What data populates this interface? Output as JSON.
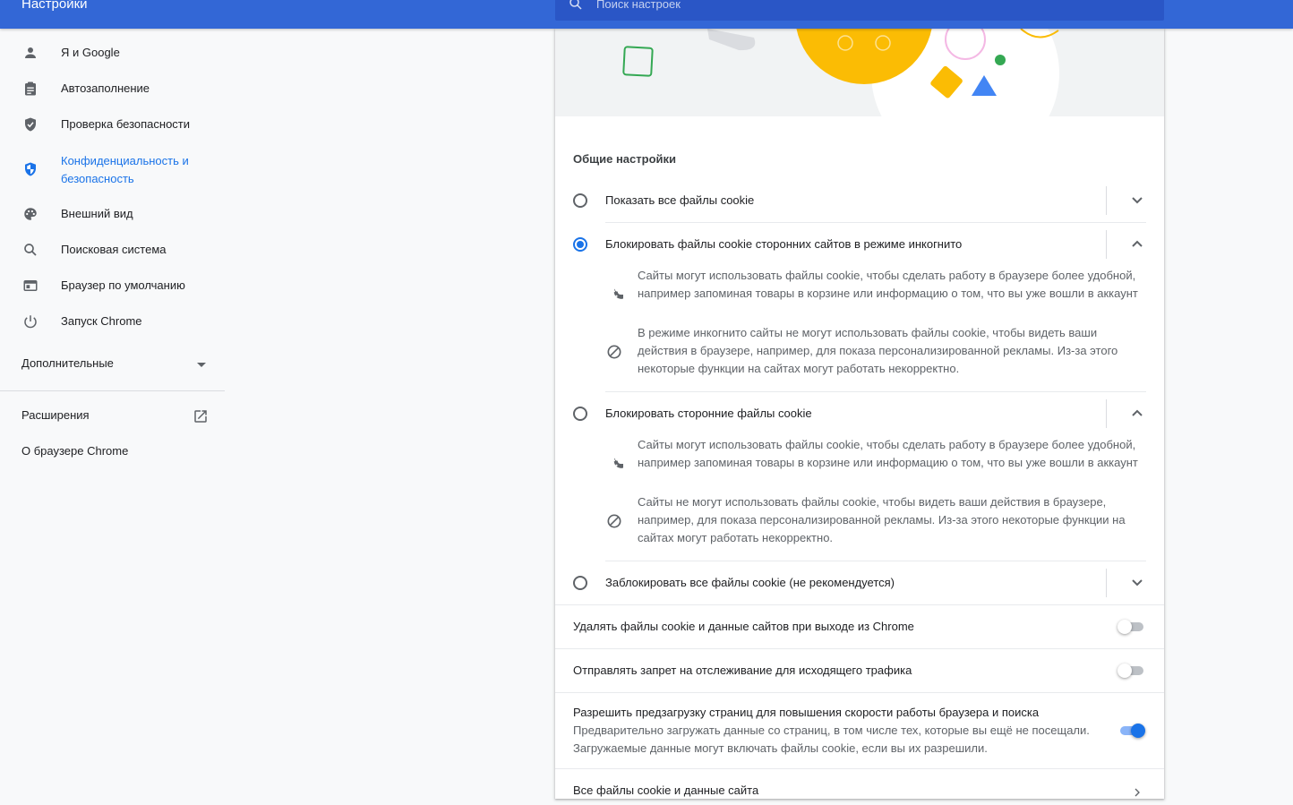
{
  "header": {
    "title": "Настройки",
    "search_placeholder": "Поиск настроек"
  },
  "sidebar": {
    "items": [
      {
        "label": "Я и Google",
        "icon": "person-icon"
      },
      {
        "label": "Автозаполнение",
        "icon": "clipboard-icon"
      },
      {
        "label": "Проверка безопасности",
        "icon": "shield-check-icon"
      },
      {
        "label": "Конфиденциальность и безопасность",
        "label_line1": "Конфиденциальность и",
        "label_line2": "безопасность",
        "icon": "shield-half-icon",
        "active": true
      },
      {
        "label": "Внешний вид",
        "icon": "palette-icon"
      },
      {
        "label": "Поисковая система",
        "icon": "search-icon"
      },
      {
        "label": "Браузер по умолчанию",
        "icon": "browser-window-icon"
      },
      {
        "label": "Запуск Chrome",
        "icon": "power-icon"
      }
    ],
    "advanced_label": "Дополнительные",
    "extensions_label": "Расширения",
    "about_label": "О браузере Chrome"
  },
  "main": {
    "section_title": "Общие настройки",
    "cookie_options": [
      {
        "label": "Показать все файлы cookie",
        "selected": false,
        "expanded": false
      },
      {
        "label": "Блокировать файлы cookie сторонних сайтов в режиме инкогнито",
        "selected": true,
        "expanded": true,
        "details": [
          {
            "icon": "cookie-icon",
            "text": "Сайты могут использовать файлы cookie, чтобы сделать работу в браузере более удобной, например запоминая товары в корзине или информацию о том, что вы уже вошли в аккаунт"
          },
          {
            "icon": "block-icon",
            "text": "В режиме инкогнито сайты не могут использовать файлы cookie, чтобы видеть ваши действия в браузере, например, для показа персонализированной рекламы. Из-за этого некоторые функции на сайтах могут работать некорректно."
          }
        ]
      },
      {
        "label": "Блокировать сторонние файлы cookie",
        "selected": false,
        "expanded": true,
        "details": [
          {
            "icon": "cookie-icon",
            "text": "Сайты могут использовать файлы cookie, чтобы сделать работу в браузере более удобной, например запоминая товары в корзине или информацию о том, что вы уже вошли в аккаунт"
          },
          {
            "icon": "block-icon",
            "text": "Сайты не могут использовать файлы cookie, чтобы видеть ваши действия в браузере, например, для показа персонализированной рекламы. Из-за этого некоторые функции на сайтах могут работать некорректно."
          }
        ]
      },
      {
        "label": "Заблокировать все файлы cookie (не рекомендуется)",
        "selected": false,
        "expanded": false
      }
    ],
    "toggles": [
      {
        "label": "Удалять файлы cookie и данные сайтов при выходе из Chrome",
        "on": false
      },
      {
        "label": "Отправлять запрет на отслеживание для исходящего трафика",
        "on": false
      },
      {
        "label": "Разрешить предзагрузку страниц для повышения скорости работы браузера и поиска",
        "sublabel": "Предварительно загружать данные со страниц, в том числе тех, которые вы ещё не посещали. Загружаемые данные могут включать файлы cookie, если вы их разрешили.",
        "on": true
      }
    ],
    "all_cookies_link": "Все файлы cookie и данные сайта"
  },
  "colors": {
    "header_bg": "#3367d6",
    "accent": "#1a73e8",
    "text_primary": "#202124",
    "text_secondary": "#5f6368"
  }
}
